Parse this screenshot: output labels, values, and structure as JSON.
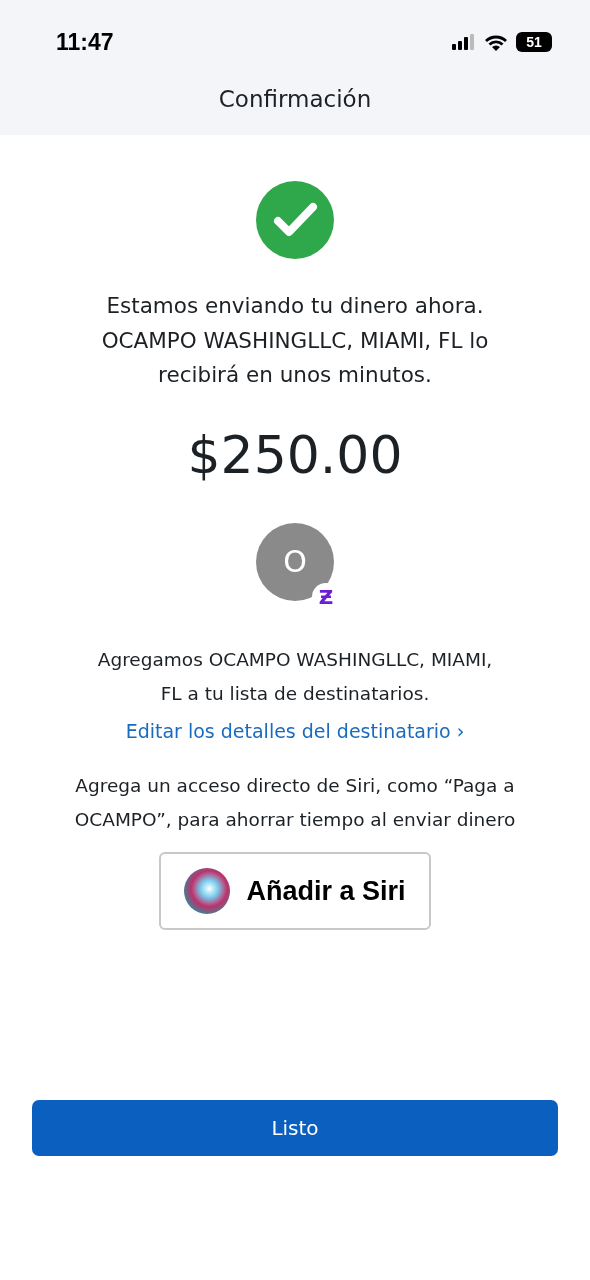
{
  "status_bar": {
    "time": "11:47",
    "battery": "51"
  },
  "header": {
    "title": "Confirmación"
  },
  "message": {
    "lines": [
      "Estamos enviando tu dinero ahora.",
      "OCAMPO WASHINGLLC, MIAMI, FL lo",
      "recibirá en unos minutos."
    ]
  },
  "amount": "$250.00",
  "recipient": {
    "initial": "O",
    "badge": "Ƶ"
  },
  "added_note": {
    "lines": [
      "Agregamos OCAMPO WASHINGLLC, MIAMI,",
      "FL a tu lista de destinatarios."
    ]
  },
  "edit_link": {
    "label": "Editar los detalles del destinatario",
    "chevron": "›"
  },
  "siri_note": {
    "lines": [
      "Agrega un acceso directo de Siri, como “Paga a",
      "OCAMPO”, para ahorrar tiempo al enviar dinero"
    ]
  },
  "siri_button": {
    "label": "Añadir a Siri"
  },
  "done_button": {
    "label": "Listo"
  }
}
